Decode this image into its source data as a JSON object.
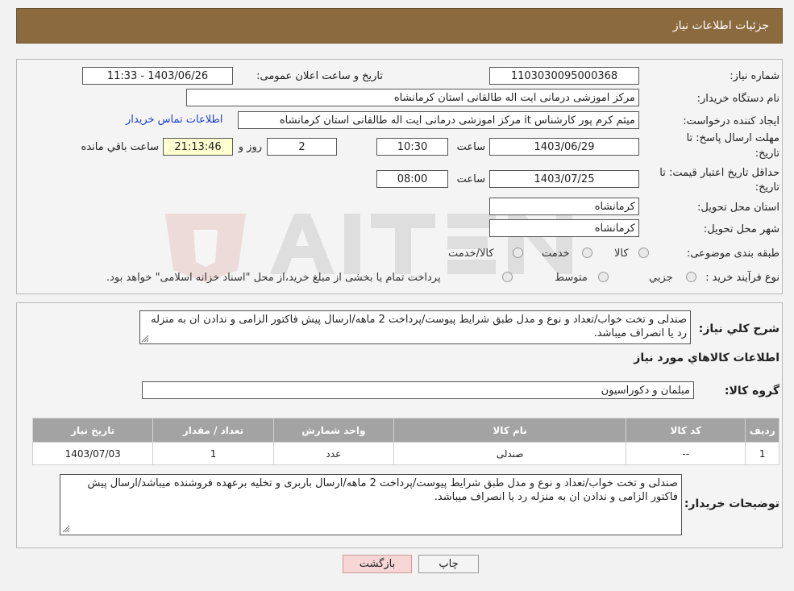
{
  "header": {
    "title": "جزئیات اطلاعات نیاز"
  },
  "form": {
    "need_number_label": "شماره نیاز:",
    "need_number": "1103030095000368",
    "announce_label": "تاریخ و ساعت اعلان عمومی:",
    "announce_value": "1403/06/26 - 11:33",
    "buyer_org_label": "نام دستگاه خریدار:",
    "buyer_org": "مرکز اموزشی درمانی ایت اله طالقانی استان کرمانشاه",
    "requester_label": "ایجاد کننده درخواست:",
    "requester": "میثم کرم پور کارشناس it مرکز اموزشی درمانی ایت اله طالقانی استان کرمانشاه",
    "contact_link": "اطلاعات تماس خریدار",
    "deadline_label_1": "مهلت ارسال پاسخ: تا",
    "deadline_label_2": "تاریخ:",
    "deadline_date": "1403/06/29",
    "time_label": "ساعت",
    "deadline_time": "10:30",
    "days_value": "2",
    "days_label": "روز و",
    "remaining_time": "21:13:46",
    "remaining_label": "ساعت باقي مانده",
    "validity_label_1": "حداقل تاریخ اعتبار قیمت: تا",
    "validity_label_2": "تاریخ:",
    "validity_date": "1403/07/25",
    "validity_time": "08:00",
    "province_label": "استان محل تحویل:",
    "province": "کرمانشاه",
    "city_label": "شهر محل تحویل:",
    "city": "کرمانشاه",
    "category_label": "طبقه بندی موضوعی:",
    "category_options": [
      "کالا",
      "خدمت",
      "کالا/خدمت"
    ],
    "process_label": "نوع فرآیند خرید :",
    "process_options": [
      "جزیي",
      "متوسط"
    ],
    "process_note": "پرداخت تمام یا بخشی از مبلغ خرید،از محل \"اسناد خزانه اسلامی\" خواهد بود."
  },
  "summary": {
    "label": "شرح کلي نياز:",
    "text": "صندلی و تخت خواب/تعداد و نوع و مدل طبق شرایط پیوست/پرداخت 2 ماهه/ارسال پیش فاکتور الزامی و ندادن ان به منزله رد یا انصراف میباشد.",
    "goods_info_title": "اطلاعات کالاهاي مورد نياز",
    "goods_group_label": "گروه کالا:",
    "goods_group": "مبلمان و دکوراسیون"
  },
  "table": {
    "headers": [
      "رديف",
      "کد کالا",
      "نام کالا",
      "واحد شمارش",
      "تعداد / مقدار",
      "تاریخ نیاز"
    ],
    "rows": [
      [
        "1",
        "--",
        "صندلی",
        "عدد",
        "1",
        "1403/07/03"
      ]
    ]
  },
  "buyer_notes": {
    "label": "توضیحات خریدار:",
    "text": "صندلی و تخت خواب/تعداد و نوع و مدل طبق شرایط پیوست/پرداخت 2 ماهه/ارسال باربری و تخلیه برعهده فروشنده میباشد/ارسال پیش فاکتور الزامی و ندادن ان به منزله رد یا انصراف میباشد."
  },
  "buttons": {
    "print": "چاپ",
    "back": "بازگشت"
  },
  "colors": {
    "header_bg": "#8b6a3d",
    "table_header_bg": "#a3a3a3",
    "link": "#1a3fd6",
    "back_button_bg": "#f7d6d6"
  }
}
